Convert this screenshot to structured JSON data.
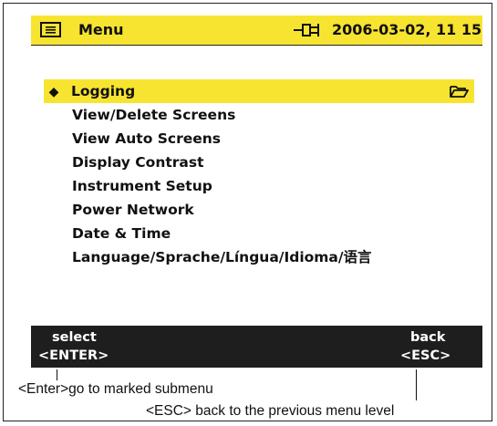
{
  "header": {
    "title": "Menu",
    "datetime": "2006-03-02, 11 15",
    "menu_icon": "menu-icon",
    "power_icon": "power-plug-icon"
  },
  "menu": {
    "items": [
      {
        "label": "Logging",
        "selected": true,
        "icon": "folder-icon"
      },
      {
        "label": "View/Delete Screens",
        "selected": false
      },
      {
        "label": "View Auto Screens",
        "selected": false
      },
      {
        "label": "Display Contrast",
        "selected": false
      },
      {
        "label": "Instrument Setup",
        "selected": false
      },
      {
        "label": "Power Network",
        "selected": false
      },
      {
        "label": "Date & Time",
        "selected": false
      },
      {
        "label": "Language/Sprache/Língua/Idioma/语言",
        "selected": false
      }
    ]
  },
  "footer": {
    "left_action": "select",
    "left_key": "<ENTER>",
    "right_action": "back",
    "right_key": "<ESC>"
  },
  "callouts": {
    "enter_note_prefix": "<Enter>",
    "enter_note_suffix": "go to marked submenu",
    "esc_note": "<ESC> back to the previous menu level"
  },
  "colors": {
    "highlight": "#f7e430",
    "footer_bg": "#1e1e1e",
    "text": "#111111"
  }
}
